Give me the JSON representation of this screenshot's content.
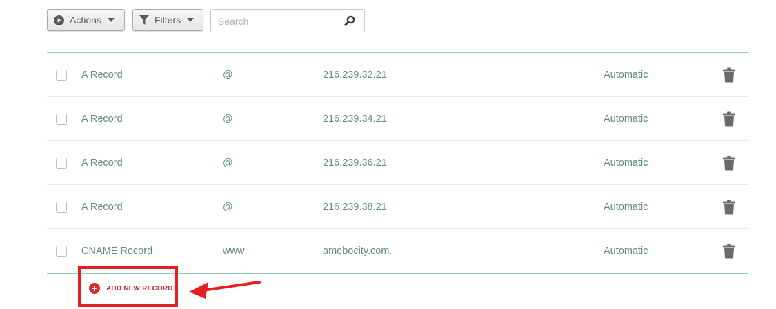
{
  "toolbar": {
    "actions_label": "Actions",
    "filters_label": "Filters",
    "search_placeholder": "Search"
  },
  "records": [
    {
      "type": "A Record",
      "host": "@",
      "value": "216.239.32.21",
      "ttl": "Automatic"
    },
    {
      "type": "A Record",
      "host": "@",
      "value": "216.239.34.21",
      "ttl": "Automatic"
    },
    {
      "type": "A Record",
      "host": "@",
      "value": "216.239.36.21",
      "ttl": "Automatic"
    },
    {
      "type": "A Record",
      "host": "@",
      "value": "216.239.38.21",
      "ttl": "Automatic"
    },
    {
      "type": "CNAME Record",
      "host": "www",
      "value": "amebocity.com.",
      "ttl": "Automatic"
    }
  ],
  "add_record": {
    "label": "ADD NEW RECORD"
  },
  "colors": {
    "accent_teal": "#8ec7c3",
    "text_teal": "#5e8a86",
    "highlight_red": "#e42020",
    "trash_gray": "#6b6b6b"
  },
  "icons": [
    "play-circle-icon",
    "chevron-down-icon",
    "filter-icon",
    "search-icon",
    "trash-icon",
    "plus-circle-icon",
    "arrow-icon"
  ]
}
